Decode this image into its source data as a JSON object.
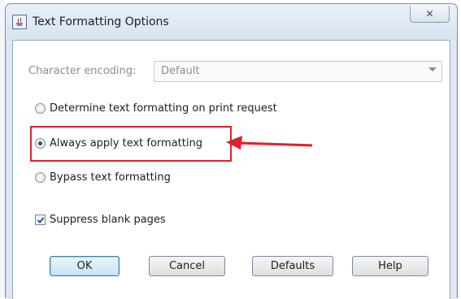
{
  "window": {
    "title": "Text Formatting Options",
    "close_label": "✕"
  },
  "encoding": {
    "label": "Character encoding:",
    "value": "Default"
  },
  "options": [
    {
      "label": "Determine text formatting on print request",
      "checked": false
    },
    {
      "label": "Always apply text formatting",
      "checked": true
    },
    {
      "label": "Bypass text formatting",
      "checked": false
    }
  ],
  "suppress": {
    "label": "Suppress blank pages",
    "checked": true
  },
  "buttons": {
    "ok": "OK",
    "cancel": "Cancel",
    "defaults": "Defaults",
    "help": "Help"
  },
  "annotation": {
    "color": "#e0202a"
  }
}
